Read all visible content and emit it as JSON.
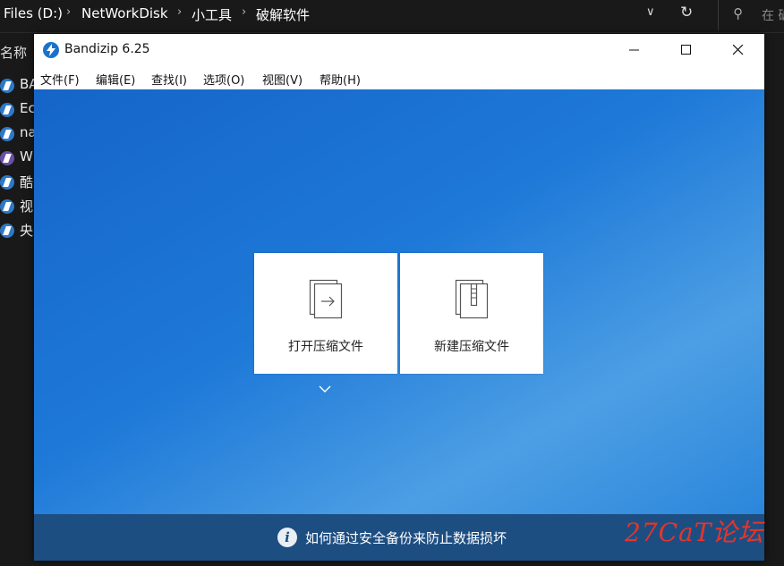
{
  "explorer": {
    "breadcrumbs": [
      "Files (D:)",
      "NetWorkDisk",
      "小工具",
      "破解软件"
    ],
    "search_placeholder": "在 破",
    "column_header": "名称",
    "files": [
      {
        "name": "BA",
        "icon": "bandizip-file-icon"
      },
      {
        "name": "Ec",
        "icon": "bandizip-file-icon"
      },
      {
        "name": "na",
        "icon": "bandizip-file-icon"
      },
      {
        "name": "W",
        "icon": "archive-file-icon-purple"
      },
      {
        "name": "酷",
        "icon": "bandizip-file-icon"
      },
      {
        "name": "视",
        "icon": "bandizip-file-icon"
      },
      {
        "name": "央",
        "icon": "bandizip-file-icon"
      }
    ]
  },
  "window": {
    "title": "Bandizip 6.25",
    "menu": [
      "文件(F)",
      "编辑(E)",
      "查找(I)",
      "选项(O)",
      "视图(V)",
      "帮助(H)"
    ]
  },
  "main": {
    "cards": [
      {
        "label": "打开压缩文件",
        "icon": "open-archive-icon"
      },
      {
        "label": "新建压缩文件",
        "icon": "new-archive-icon"
      }
    ]
  },
  "infobar": {
    "text": "如何通过安全备份来防止数据损坏"
  },
  "watermark": "27CaT论坛",
  "colors": {
    "accent": "#1e79d8",
    "infobar": "#1d4e82",
    "watermark": "#e8342a"
  }
}
